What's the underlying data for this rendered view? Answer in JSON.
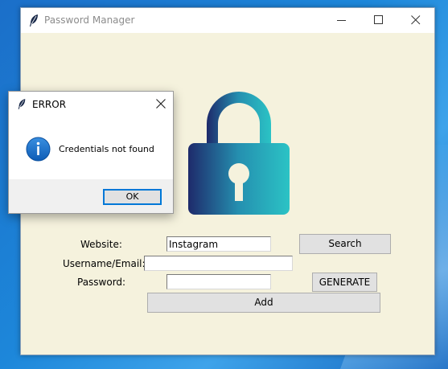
{
  "main_window": {
    "title": "Password Manager",
    "form": {
      "website_label": "Website:",
      "website_value": "Instagram",
      "username_label": "Username/Email:",
      "username_value": "",
      "password_label": "Password:",
      "password_value": "",
      "search_label": "Search",
      "generate_label": "GENERATE",
      "add_label": "Add"
    },
    "logo": "padlock-icon",
    "colors": {
      "background": "#f5f2dd",
      "lock_gradient_start": "#1e2a6b",
      "lock_gradient_end": "#2bc3c5"
    }
  },
  "dialog": {
    "title": "ERROR",
    "message": "Credentials not found",
    "ok_label": "OK",
    "icon": "info-icon"
  }
}
